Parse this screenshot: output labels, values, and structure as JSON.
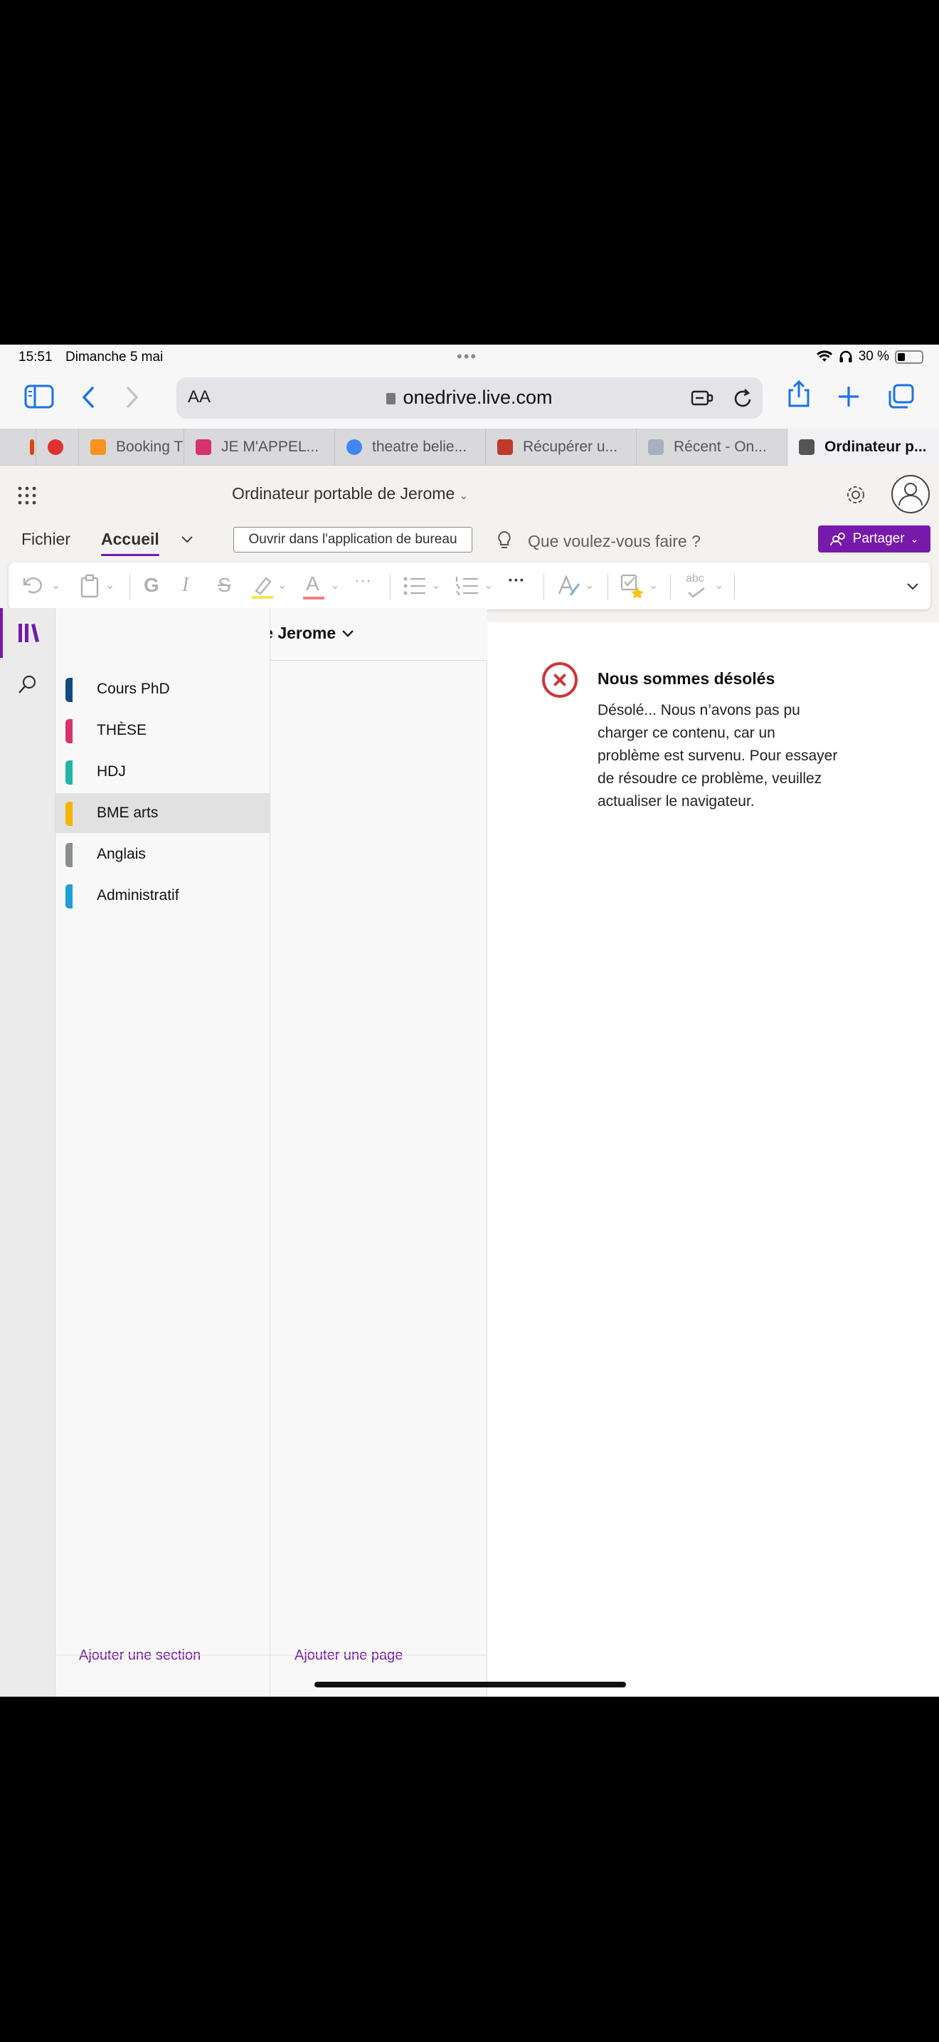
{
  "status_bar": {
    "time": "15:51",
    "date": "Dimanche 5 mai",
    "battery_text": "30 %",
    "battery_level": 0.3
  },
  "browser": {
    "aa_label": "AA",
    "url": "onedrive.live.com",
    "tabs": [
      {
        "label": "Booking T",
        "favicon_color": "#f7931e"
      },
      {
        "label": "JE M'APPEL...",
        "favicon_color": "#d6336c"
      },
      {
        "label": "theatre belie...",
        "favicon_color": "#4285f4"
      },
      {
        "label": "Récupérer u...",
        "favicon_color": "#c0392b"
      },
      {
        "label": "Récent - On...",
        "favicon_color": "#a9b0bd"
      },
      {
        "label": "Ordinateur p...",
        "favicon_color": "#555555"
      }
    ]
  },
  "app": {
    "notebook_title": "Ordinateur portable de Jerome",
    "ribbon_tabs": [
      "Fichier",
      "Accueil"
    ],
    "open_desktop_label": "Ouvrir dans l'application de bureau",
    "tell_me_placeholder": "Que voulez-vous faire ?",
    "share_label": "Partager",
    "accent_color": "#7719aa",
    "ribbon_icons": {
      "bold": "G",
      "italic": "I",
      "strike": "S",
      "font_color": "A",
      "more": "···",
      "spell": "abc"
    }
  },
  "navigation": {
    "notebook_name": "Ordinateur portable de Jerome",
    "sections": [
      {
        "label": "Cours PhD",
        "color": "#0f4c81"
      },
      {
        "label": "THÈSE",
        "color": "#d6336c"
      },
      {
        "label": "HDJ",
        "color": "#1fb6a6"
      },
      {
        "label": "BME arts",
        "color": "#f5b400"
      },
      {
        "label": "Anglais",
        "color": "#8a8d91"
      },
      {
        "label": "Administratif",
        "color": "#1e9fd6"
      }
    ],
    "add_section_label": "Ajouter une section",
    "add_page_label": "Ajouter une page"
  },
  "error": {
    "title": "Nous sommes désolés",
    "message": "Désolé... Nous n’avons pas pu charger ce contenu, car un problème est survenu. Pour essayer de résoudre ce problème, veuillez actualiser le navigateur."
  }
}
